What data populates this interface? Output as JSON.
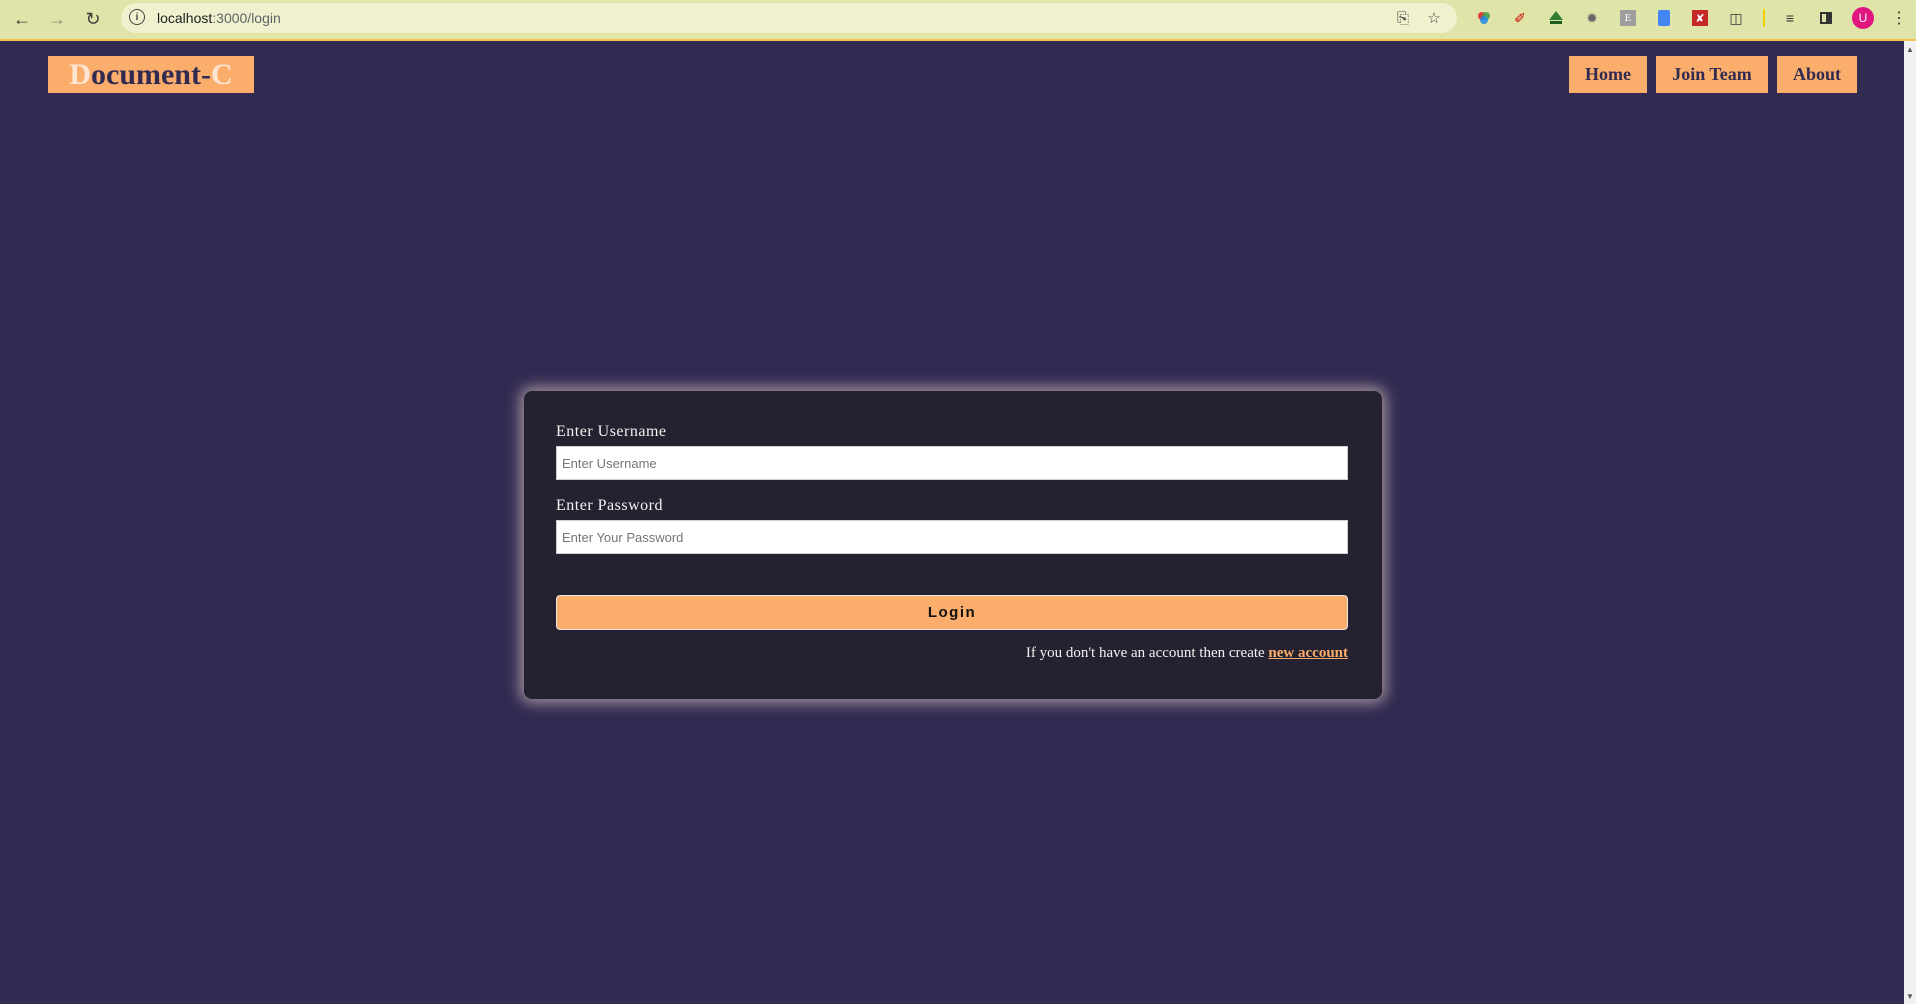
{
  "browser": {
    "url_host": "localhost",
    "url_path": ":3000/login",
    "avatar_letter": "U",
    "icons": [
      "back-arrow-icon",
      "forward-arrow-icon",
      "reload-icon",
      "info-icon",
      "install-app-icon",
      "bookmark-star-icon",
      "color-wheel-extension-icon",
      "pen-extension-icon",
      "tree-extension-icon",
      "bug-extension-icon",
      "e-extension-icon",
      "doc-extension-icon",
      "red-extension-icon",
      "puzzle-extensions-icon",
      "media-queue-icon",
      "side-panel-icon",
      "kebab-menu-icon"
    ]
  },
  "header": {
    "logo_first": "D",
    "logo_middle": "ocument-",
    "logo_last": "C",
    "nav": [
      "Home",
      "Join Team",
      "About"
    ]
  },
  "login": {
    "username_label": "Enter Username",
    "username_placeholder": "Enter Username",
    "password_label": "Enter Password",
    "password_placeholder": "Enter Your Password",
    "submit_label": "Login",
    "signup_text": "If you don't have an account then create ",
    "signup_link": "new account"
  },
  "colors": {
    "page_bg": "#322b51",
    "accent": "#fbad6c",
    "card_bg": "#242230"
  }
}
